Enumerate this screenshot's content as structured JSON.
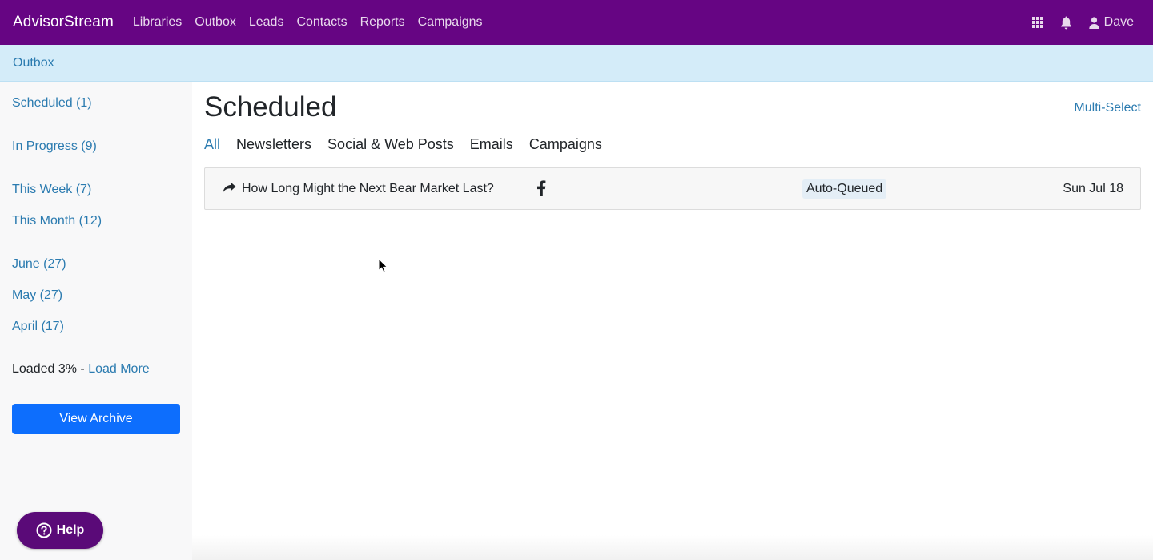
{
  "navbar": {
    "brand": "AdvisorStream",
    "links": [
      "Libraries",
      "Outbox",
      "Leads",
      "Contacts",
      "Reports",
      "Campaigns"
    ],
    "icons": [
      "grid-icon",
      "bell-icon",
      "user-icon"
    ],
    "user_name": "Dave",
    "bg_color": "#660583"
  },
  "breadcrumb": {
    "current": "Outbox"
  },
  "sidebar": {
    "items": [
      "Scheduled (1)",
      "In Progress (9)",
      "This Week (7)",
      "This Month (12)",
      "June (27)",
      "May (27)",
      "April (17)"
    ],
    "loaded_text": "Loaded 3% - ",
    "load_more": "Load More",
    "archive_button": "View Archive",
    "help_button": "Help"
  },
  "main": {
    "title": "Scheduled",
    "multi_select": "Multi-Select",
    "tabs": [
      "All",
      "Newsletters",
      "Social & Web Posts",
      "Emails",
      "Campaigns"
    ],
    "active_tab": "All",
    "rows": [
      {
        "title": "How Long Might the Next Bear Market Last?",
        "channel_icon": "facebook-icon",
        "type_icon": "share-icon",
        "status": "Auto-Queued",
        "date": "Sun Jul 18"
      }
    ]
  }
}
